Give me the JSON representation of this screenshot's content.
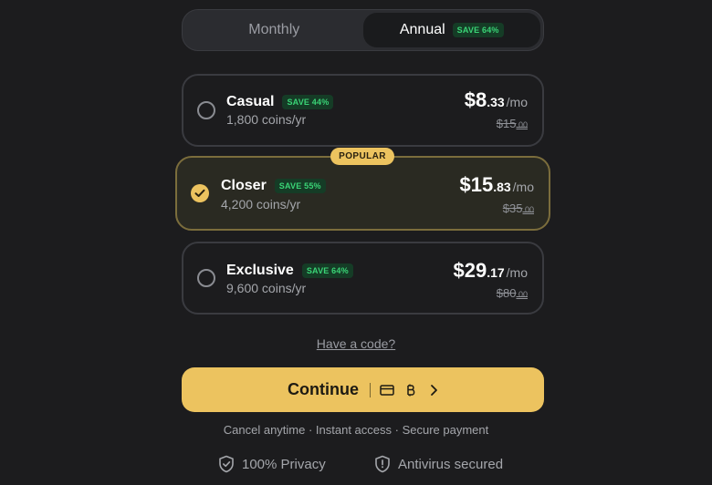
{
  "billing": {
    "monthly_label": "Monthly",
    "annual_label": "Annual",
    "annual_badge": "SAVE 64%",
    "selected": "Annual"
  },
  "plans": [
    {
      "name": "Casual",
      "badge": "SAVE 44%",
      "coins": "1,800 coins/yr",
      "price_main": "$8",
      "price_cents": ".33",
      "price_unit": "/mo",
      "old_price": "$15",
      "old_cents": ".00",
      "selected": false
    },
    {
      "name": "Closer",
      "badge": "SAVE 55%",
      "coins": "4,200 coins/yr",
      "price_main": "$15",
      "price_cents": ".83",
      "price_unit": "/mo",
      "old_price": "$35",
      "old_cents": ".00",
      "selected": true,
      "tag": "POPULAR"
    },
    {
      "name": "Exclusive",
      "badge": "SAVE 64%",
      "coins": "9,600 coins/yr",
      "price_main": "$29",
      "price_cents": ".17",
      "price_unit": "/mo",
      "old_price": "$80",
      "old_cents": ".00",
      "selected": false
    }
  ],
  "code_link": "Have a code?",
  "continue": {
    "label": "Continue",
    "icons": [
      "credit-card-icon",
      "bitcoin-icon",
      "chevron-right-icon"
    ]
  },
  "footer": "Cancel anytime · Instant access · Secure payment",
  "trust": {
    "privacy": "100% Privacy",
    "antivirus": "Antivirus secured"
  },
  "colors": {
    "background": "#1c1c1e",
    "accent": "#ecc35f",
    "save_badge_bg": "#153c26",
    "save_badge_text": "#3ad476"
  }
}
